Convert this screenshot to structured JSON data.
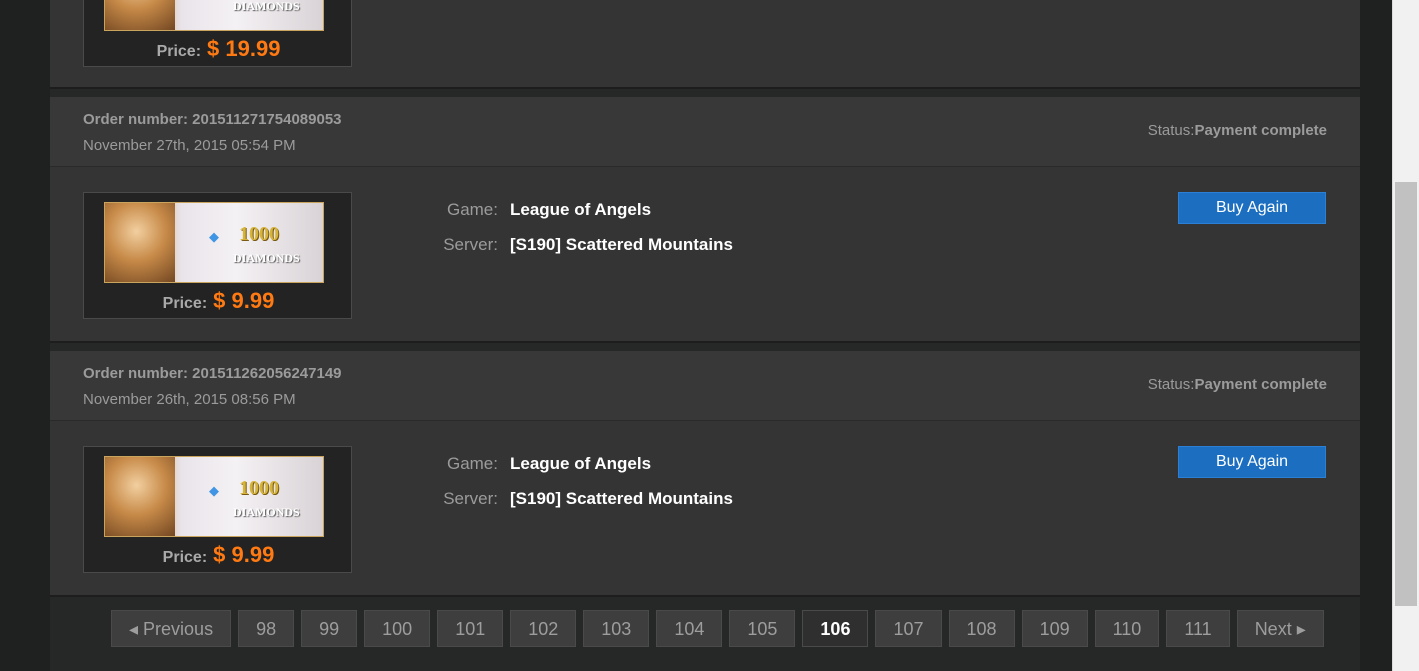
{
  "top_order": {
    "price_label": "Price:",
    "price_value": "$ 19.99",
    "banner_word": "DIAMONDS"
  },
  "orders": [
    {
      "order_number_label": "Order number: 201511271754089053",
      "date": "November 27th, 2015  05:54 PM",
      "status_label": "Status:",
      "status_value": "Payment complete",
      "banner_amount": "1000",
      "banner_word": "DIAMONDS",
      "price_label": "Price:",
      "price_value": "$ 9.99",
      "game_label": "Game:",
      "game_value": "League of Angels",
      "server_label": "Server:",
      "server_value": "[S190] Scattered Mountains",
      "buy_again": "Buy Again"
    },
    {
      "order_number_label": "Order number: 201511262056247149",
      "date": "November 26th, 2015  08:56 PM",
      "status_label": "Status:",
      "status_value": "Payment complete",
      "banner_amount": "1000",
      "banner_word": "DIAMONDS",
      "price_label": "Price:",
      "price_value": "$ 9.99",
      "game_label": "Game:",
      "game_value": "League of Angels",
      "server_label": "Server:",
      "server_value": "[S190] Scattered Mountains",
      "buy_again": "Buy Again"
    }
  ],
  "pagination": {
    "previous": "◂ Previous",
    "next": "Next ▸",
    "pages": [
      "98",
      "99",
      "100",
      "101",
      "102",
      "103",
      "104",
      "105",
      "106",
      "107",
      "108",
      "109",
      "110",
      "111"
    ],
    "current": "106"
  }
}
